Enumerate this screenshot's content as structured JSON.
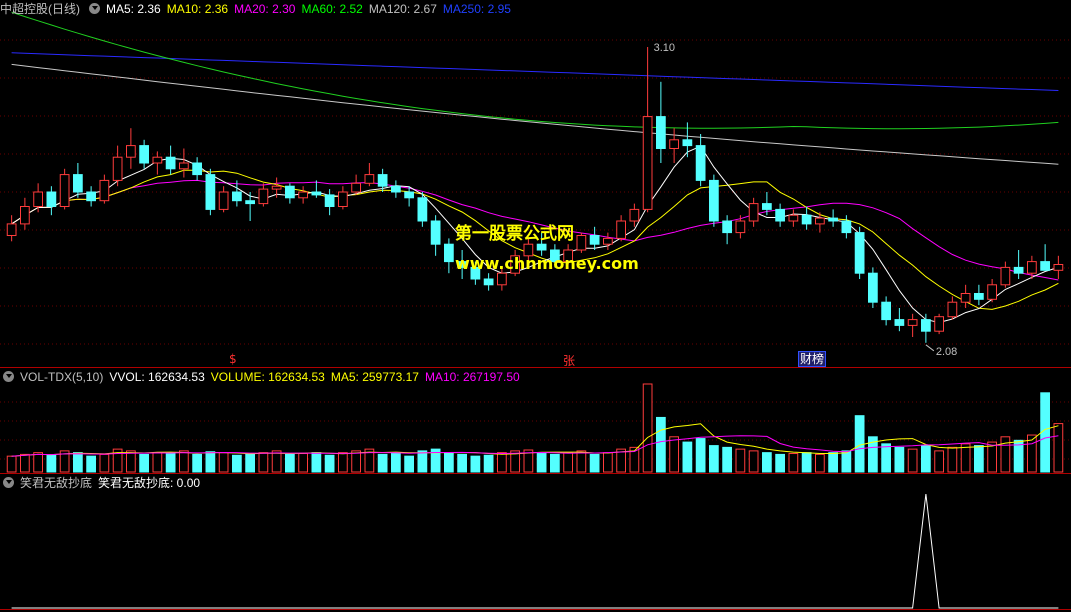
{
  "main_legend": {
    "title": "中超控股(日线)",
    "ma5": "MA5: 2.36",
    "ma10": "MA10: 2.36",
    "ma20": "MA20: 2.30",
    "ma60": "MA60: 2.52",
    "ma120": "MA120: 2.67",
    "ma250": "MA250: 2.95",
    "colors": {
      "ma5": "#ffffff",
      "ma10": "#ffff00",
      "ma20": "#ff00ff",
      "ma60": "#00ff00",
      "ma120": "#c0c0c0",
      "ma250": "#0000ff"
    }
  },
  "vol_legend": {
    "name": "VOL-TDX(5,10)",
    "vvol": "VVOL: 162634.53",
    "volume": "VOLUME: 162634.53",
    "ma5": "MA5: 259773.17",
    "ma10": "MA10: 267197.50"
  },
  "ind_legend": {
    "name": "笑君无敌抄底",
    "value": "笑君无敌抄底: 0.00"
  },
  "watermark": {
    "line1": "第一股票公式网",
    "line2": "www.chnmoney.com"
  },
  "annotations": {
    "high_label": "3.10",
    "low_label": "2.08",
    "event_1": "$",
    "event_2": "张",
    "event_3": "财榜"
  },
  "chart_data": {
    "type": "candlestick",
    "title": "中超控股(日线)",
    "price_range": [
      2.0,
      3.2
    ],
    "high": 3.1,
    "low": 2.08,
    "up_color": "#ff3c3c",
    "down_color": "#54ffff",
    "ohlc": [
      [
        2.45,
        2.52,
        2.43,
        2.49
      ],
      [
        2.49,
        2.58,
        2.47,
        2.55
      ],
      [
        2.55,
        2.63,
        2.53,
        2.6
      ],
      [
        2.6,
        2.62,
        2.52,
        2.55
      ],
      [
        2.55,
        2.68,
        2.54,
        2.66
      ],
      [
        2.66,
        2.7,
        2.58,
        2.6
      ],
      [
        2.6,
        2.62,
        2.55,
        2.57
      ],
      [
        2.57,
        2.66,
        2.56,
        2.64
      ],
      [
        2.64,
        2.76,
        2.62,
        2.72
      ],
      [
        2.72,
        2.82,
        2.68,
        2.76
      ],
      [
        2.76,
        2.78,
        2.68,
        2.7
      ],
      [
        2.7,
        2.74,
        2.66,
        2.72
      ],
      [
        2.72,
        2.76,
        2.66,
        2.68
      ],
      [
        2.68,
        2.75,
        2.65,
        2.7
      ],
      [
        2.7,
        2.72,
        2.64,
        2.66
      ],
      [
        2.66,
        2.68,
        2.52,
        2.54
      ],
      [
        2.54,
        2.62,
        2.53,
        2.6
      ],
      [
        2.6,
        2.64,
        2.55,
        2.57
      ],
      [
        2.57,
        2.6,
        2.5,
        2.56
      ],
      [
        2.56,
        2.63,
        2.55,
        2.61
      ],
      [
        2.61,
        2.65,
        2.58,
        2.62
      ],
      [
        2.62,
        2.63,
        2.56,
        2.58
      ],
      [
        2.58,
        2.62,
        2.56,
        2.6
      ],
      [
        2.6,
        2.64,
        2.58,
        2.59
      ],
      [
        2.59,
        2.61,
        2.52,
        2.55
      ],
      [
        2.55,
        2.62,
        2.54,
        2.6
      ],
      [
        2.6,
        2.66,
        2.59,
        2.63
      ],
      [
        2.63,
        2.7,
        2.62,
        2.66
      ],
      [
        2.66,
        2.68,
        2.6,
        2.62
      ],
      [
        2.62,
        2.64,
        2.58,
        2.6
      ],
      [
        2.6,
        2.62,
        2.55,
        2.58
      ],
      [
        2.58,
        2.6,
        2.48,
        2.5
      ],
      [
        2.5,
        2.52,
        2.38,
        2.42
      ],
      [
        2.42,
        2.44,
        2.32,
        2.36
      ],
      [
        2.36,
        2.4,
        2.3,
        2.34
      ],
      [
        2.34,
        2.36,
        2.28,
        2.3
      ],
      [
        2.3,
        2.32,
        2.26,
        2.28
      ],
      [
        2.28,
        2.34,
        2.26,
        2.32
      ],
      [
        2.32,
        2.4,
        2.31,
        2.38
      ],
      [
        2.38,
        2.44,
        2.36,
        2.42
      ],
      [
        2.42,
        2.46,
        2.38,
        2.4
      ],
      [
        2.4,
        2.42,
        2.34,
        2.36
      ],
      [
        2.36,
        2.42,
        2.35,
        2.4
      ],
      [
        2.4,
        2.46,
        2.39,
        2.45
      ],
      [
        2.45,
        2.48,
        2.4,
        2.42
      ],
      [
        2.42,
        2.46,
        2.4,
        2.44
      ],
      [
        2.44,
        2.52,
        2.43,
        2.5
      ],
      [
        2.5,
        2.56,
        2.48,
        2.54
      ],
      [
        2.54,
        3.1,
        2.53,
        2.86
      ],
      [
        2.86,
        2.98,
        2.7,
        2.75
      ],
      [
        2.75,
        2.82,
        2.7,
        2.78
      ],
      [
        2.78,
        2.84,
        2.72,
        2.76
      ],
      [
        2.76,
        2.8,
        2.62,
        2.64
      ],
      [
        2.64,
        2.66,
        2.48,
        2.5
      ],
      [
        2.5,
        2.52,
        2.42,
        2.46
      ],
      [
        2.46,
        2.52,
        2.44,
        2.5
      ],
      [
        2.5,
        2.58,
        2.48,
        2.56
      ],
      [
        2.56,
        2.6,
        2.52,
        2.54
      ],
      [
        2.54,
        2.56,
        2.48,
        2.5
      ],
      [
        2.5,
        2.54,
        2.48,
        2.52
      ],
      [
        2.52,
        2.55,
        2.47,
        2.49
      ],
      [
        2.49,
        2.53,
        2.46,
        2.51
      ],
      [
        2.51,
        2.54,
        2.48,
        2.5
      ],
      [
        2.5,
        2.52,
        2.44,
        2.46
      ],
      [
        2.46,
        2.48,
        2.3,
        2.32
      ],
      [
        2.32,
        2.34,
        2.2,
        2.22
      ],
      [
        2.22,
        2.24,
        2.14,
        2.16
      ],
      [
        2.16,
        2.2,
        2.12,
        2.14
      ],
      [
        2.14,
        2.18,
        2.1,
        2.16
      ],
      [
        2.16,
        2.18,
        2.08,
        2.12
      ],
      [
        2.12,
        2.18,
        2.11,
        2.17
      ],
      [
        2.17,
        2.24,
        2.16,
        2.22
      ],
      [
        2.22,
        2.28,
        2.2,
        2.25
      ],
      [
        2.25,
        2.28,
        2.21,
        2.23
      ],
      [
        2.23,
        2.3,
        2.22,
        2.28
      ],
      [
        2.28,
        2.36,
        2.27,
        2.34
      ],
      [
        2.34,
        2.4,
        2.3,
        2.32
      ],
      [
        2.32,
        2.38,
        2.3,
        2.36
      ],
      [
        2.36,
        2.42,
        2.34,
        2.33
      ],
      [
        2.33,
        2.38,
        2.3,
        2.35
      ]
    ],
    "volume": [
      0.18,
      0.2,
      0.22,
      0.19,
      0.24,
      0.22,
      0.18,
      0.2,
      0.26,
      0.24,
      0.2,
      0.22,
      0.21,
      0.24,
      0.2,
      0.23,
      0.22,
      0.19,
      0.2,
      0.22,
      0.24,
      0.2,
      0.21,
      0.22,
      0.19,
      0.22,
      0.24,
      0.26,
      0.2,
      0.21,
      0.18,
      0.24,
      0.26,
      0.22,
      0.2,
      0.18,
      0.19,
      0.22,
      0.24,
      0.25,
      0.22,
      0.2,
      0.22,
      0.24,
      0.2,
      0.22,
      0.26,
      0.28,
      1.0,
      0.62,
      0.4,
      0.34,
      0.38,
      0.3,
      0.28,
      0.26,
      0.24,
      0.22,
      0.2,
      0.21,
      0.22,
      0.2,
      0.22,
      0.24,
      0.64,
      0.4,
      0.32,
      0.28,
      0.26,
      0.3,
      0.24,
      0.28,
      0.32,
      0.3,
      0.34,
      0.4,
      0.36,
      0.42,
      0.9,
      0.55
    ],
    "volume_up_color": "#ff3c3c",
    "volume_down_color": "#54ffff",
    "indicator": {
      "name": "笑君无敌抄底",
      "values_nonzero_at": [
        69
      ],
      "peak": 1
    }
  }
}
